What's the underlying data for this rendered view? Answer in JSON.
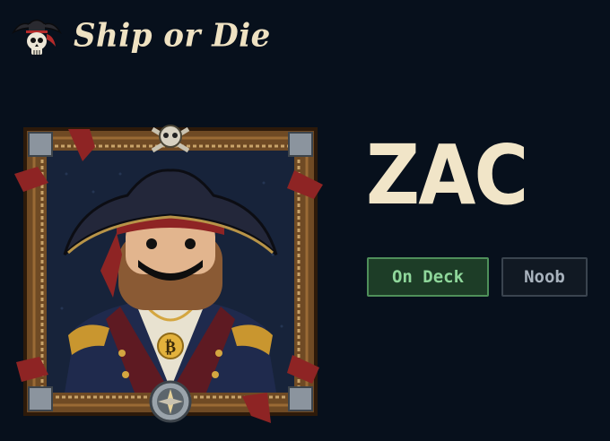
{
  "app": {
    "title": "Ship or Die",
    "logo_icon": "pirate-skull-logo-icon"
  },
  "profile": {
    "name": "ZAC",
    "status_badge": "On Deck",
    "rank_badge": "Noob",
    "portrait_icon": "pirate-captain-portrait"
  },
  "colors": {
    "background": "#07101c",
    "text_cream": "#f1e5c8",
    "status_green_bg": "#1d3d27",
    "status_green_border": "#4f8f5a",
    "status_green_text": "#8fd79b",
    "rank_gray_bg": "#111923",
    "rank_gray_border": "#3a444f",
    "rank_gray_text": "#a8b2bd"
  }
}
